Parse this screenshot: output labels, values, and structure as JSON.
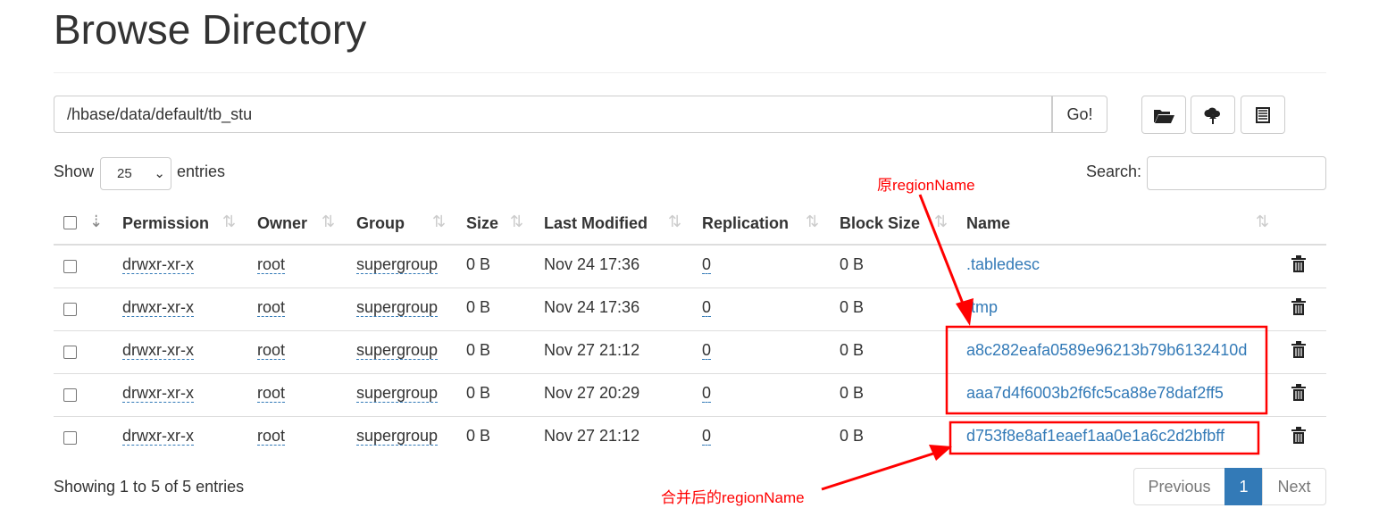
{
  "title": "Browse Directory",
  "path": "/hbase/data/default/tb_stu",
  "go_label": "Go!",
  "toolbar": {
    "icons": [
      "folder-open-icon",
      "cloud-upload-icon",
      "list-icon"
    ]
  },
  "show_label": "Show",
  "entries_label": "entries",
  "page_size": "25",
  "search_label": "Search:",
  "search_value": "",
  "columns": [
    "Permission",
    "Owner",
    "Group",
    "Size",
    "Last Modified",
    "Replication",
    "Block Size",
    "Name"
  ],
  "rows": [
    {
      "permission": "drwxr-xr-x",
      "owner": "root",
      "group": "supergroup",
      "size": "0 B",
      "modified": "Nov 24 17:36",
      "replication": "0",
      "block_size": "0 B",
      "name": ".tabledesc"
    },
    {
      "permission": "drwxr-xr-x",
      "owner": "root",
      "group": "supergroup",
      "size": "0 B",
      "modified": "Nov 24 17:36",
      "replication": "0",
      "block_size": "0 B",
      "name": ".tmp"
    },
    {
      "permission": "drwxr-xr-x",
      "owner": "root",
      "group": "supergroup",
      "size": "0 B",
      "modified": "Nov 27 21:12",
      "replication": "0",
      "block_size": "0 B",
      "name": "a8c282eafa0589e96213b79b6132410d"
    },
    {
      "permission": "drwxr-xr-x",
      "owner": "root",
      "group": "supergroup",
      "size": "0 B",
      "modified": "Nov 27 20:29",
      "replication": "0",
      "block_size": "0 B",
      "name": "aaa7d4f6003b2f6fc5ca88e78daf2ff5"
    },
    {
      "permission": "drwxr-xr-x",
      "owner": "root",
      "group": "supergroup",
      "size": "0 B",
      "modified": "Nov 27 21:12",
      "replication": "0",
      "block_size": "0 B",
      "name": "d753f8e8af1eaef1aa0e1a6c2d2bfbff"
    }
  ],
  "footer": {
    "info": "Showing 1 to 5 of 5 entries",
    "previous": "Previous",
    "page": "1",
    "next": "Next"
  },
  "annotations": {
    "original": "原regionName",
    "merged": "合并后的regionName",
    "color": "#ff0000"
  },
  "colors": {
    "link": "#337ab7",
    "active_page": "#337ab7"
  }
}
